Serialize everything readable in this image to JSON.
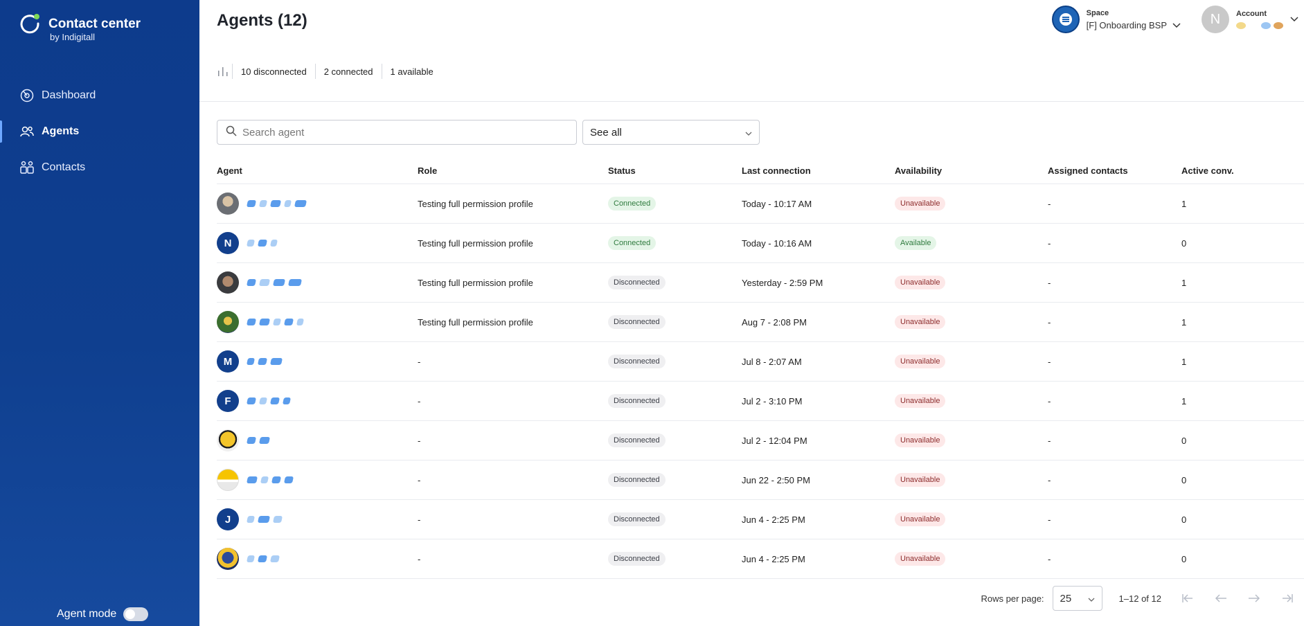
{
  "sidebar": {
    "brand_title": "Contact center",
    "brand_subtitle": "by Indigitall",
    "items": [
      {
        "label": "Dashboard",
        "icon": "dashboard-icon"
      },
      {
        "label": "Agents",
        "icon": "agents-icon",
        "active": true
      },
      {
        "label": "Contacts",
        "icon": "contacts-icon"
      }
    ],
    "agent_mode_label": "Agent mode",
    "agent_mode_on": false
  },
  "header": {
    "title": "Agents (12)",
    "space_label": "Space",
    "space_value": "[F] Onboarding BSP",
    "account_label": "Account",
    "account_initial": "N"
  },
  "stats": {
    "disconnected": "10 disconnected",
    "connected": "2 connected",
    "available": "1 available"
  },
  "filters": {
    "search_placeholder": "Search agent",
    "select_value": "See all"
  },
  "table": {
    "columns": [
      "Agent",
      "Role",
      "Status",
      "Last connection",
      "Availability",
      "Assigned contacts",
      "Active conv."
    ],
    "rows": [
      {
        "avatar": "photo1",
        "initial": "",
        "role": "Testing full permission profile",
        "status": "Connected",
        "last": "Today - 10:17 AM",
        "availability": "Unavailable",
        "assigned": "-",
        "active": "1"
      },
      {
        "avatar": "letter",
        "initial": "N",
        "role": "Testing full permission profile",
        "status": "Connected",
        "last": "Today - 10:16 AM",
        "availability": "Available",
        "assigned": "-",
        "active": "0"
      },
      {
        "avatar": "photo2",
        "initial": "",
        "role": "Testing full permission profile",
        "status": "Disconnected",
        "last": "Yesterday - 2:59 PM",
        "availability": "Unavailable",
        "assigned": "-",
        "active": "1"
      },
      {
        "avatar": "photo3",
        "initial": "",
        "role": "Testing full permission profile",
        "status": "Disconnected",
        "last": "Aug 7 - 2:08 PM",
        "availability": "Unavailable",
        "assigned": "-",
        "active": "1"
      },
      {
        "avatar": "letter",
        "initial": "M",
        "role": "-",
        "status": "Disconnected",
        "last": "Jul 8 - 2:07 AM",
        "availability": "Unavailable",
        "assigned": "-",
        "active": "1"
      },
      {
        "avatar": "letter",
        "initial": "F",
        "role": "-",
        "status": "Disconnected",
        "last": "Jul 2 - 3:10 PM",
        "availability": "Unavailable",
        "assigned": "-",
        "active": "1"
      },
      {
        "avatar": "photo4",
        "initial": "",
        "role": "-",
        "status": "Disconnected",
        "last": "Jul 2 - 12:04 PM",
        "availability": "Unavailable",
        "assigned": "-",
        "active": "0"
      },
      {
        "avatar": "photo5",
        "initial": "",
        "role": "-",
        "status": "Disconnected",
        "last": "Jun 22 - 2:50 PM",
        "availability": "Unavailable",
        "assigned": "-",
        "active": "0"
      },
      {
        "avatar": "letter",
        "initial": "J",
        "role": "-",
        "status": "Disconnected",
        "last": "Jun 4 - 2:25 PM",
        "availability": "Unavailable",
        "assigned": "-",
        "active": "0"
      },
      {
        "avatar": "photo6",
        "initial": "",
        "role": "-",
        "status": "Disconnected",
        "last": "Jun 4 - 2:25 PM",
        "availability": "Unavailable",
        "assigned": "-",
        "active": "0"
      }
    ]
  },
  "pagination": {
    "rows_per_page_label": "Rows per page:",
    "rows_per_page": "25",
    "range": "1–12 of 12"
  },
  "colors": {
    "sidebar": "#0f3f8f",
    "accent": "#6ea8ff"
  }
}
